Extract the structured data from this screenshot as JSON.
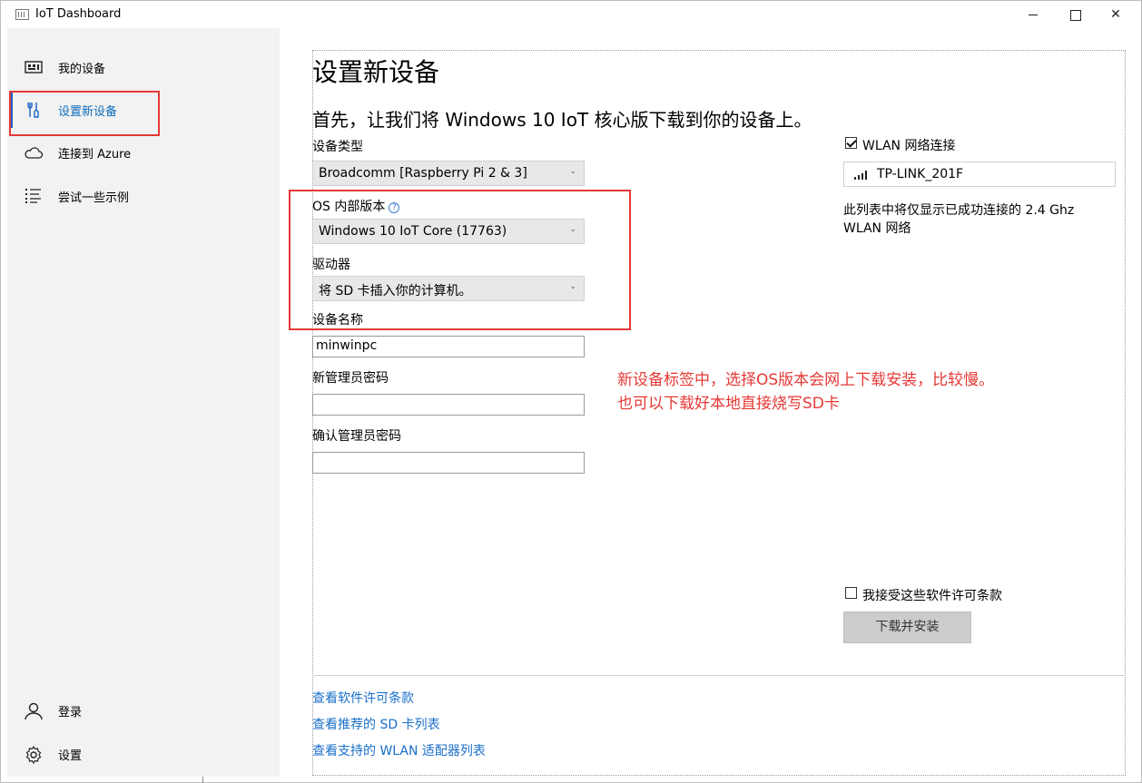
{
  "window": {
    "title": "IoT Dashboard"
  },
  "sidebar": {
    "items": [
      {
        "label": "我的设备",
        "icon": "devices-icon"
      },
      {
        "label": "设置新设备",
        "icon": "tools-icon",
        "active": true
      },
      {
        "label": "连接到 Azure",
        "icon": "cloud-icon"
      },
      {
        "label": "尝试一些示例",
        "icon": "list-icon"
      }
    ],
    "bottom": [
      {
        "label": "登录",
        "icon": "person-icon"
      },
      {
        "label": "设置",
        "icon": "gear-icon"
      }
    ]
  },
  "main": {
    "title": "设置新设备",
    "subtitle": "首先，让我们将 Windows 10 IoT 核心版下载到你的设备上。",
    "device_type": {
      "label": "设备类型",
      "value": "Broadcomm [Raspberry Pi 2 & 3]"
    },
    "os_build": {
      "label": "OS 内部版本",
      "value": "Windows 10 IoT Core (17763)"
    },
    "drive": {
      "label": "驱动器",
      "value": "将 SD 卡插入你的计算机。"
    },
    "device_name": {
      "label": "设备名称",
      "value": "minwinpc"
    },
    "new_password": {
      "label": "新管理员密码",
      "value": ""
    },
    "confirm_password": {
      "label": "确认管理员密码",
      "value": ""
    },
    "wlan": {
      "label": "WLAN 网络连接",
      "checked": true,
      "network": "TP-LINK_201F",
      "note": "此列表中将仅显示已成功连接的 2.4 Ghz WLAN 网络"
    },
    "license": {
      "label": "我接受这些软件许可条款",
      "checked": false
    },
    "install_button": "下载并安装",
    "links": [
      "查看软件许可条款",
      "查看推荐的 SD 卡列表",
      "查看支持的 WLAN 适配器列表"
    ]
  },
  "annotation": {
    "line1": "新设备标签中，选择OS版本会网上下载安装，比较慢。",
    "line2": "也可以下载好本地直接烧写SD卡",
    "color": "#e53935"
  },
  "colors": {
    "accent": "#0f6cbd",
    "sidebar_bg": "#f2f2f2",
    "link": "#1a6fc9",
    "highlight": "#e53935"
  }
}
